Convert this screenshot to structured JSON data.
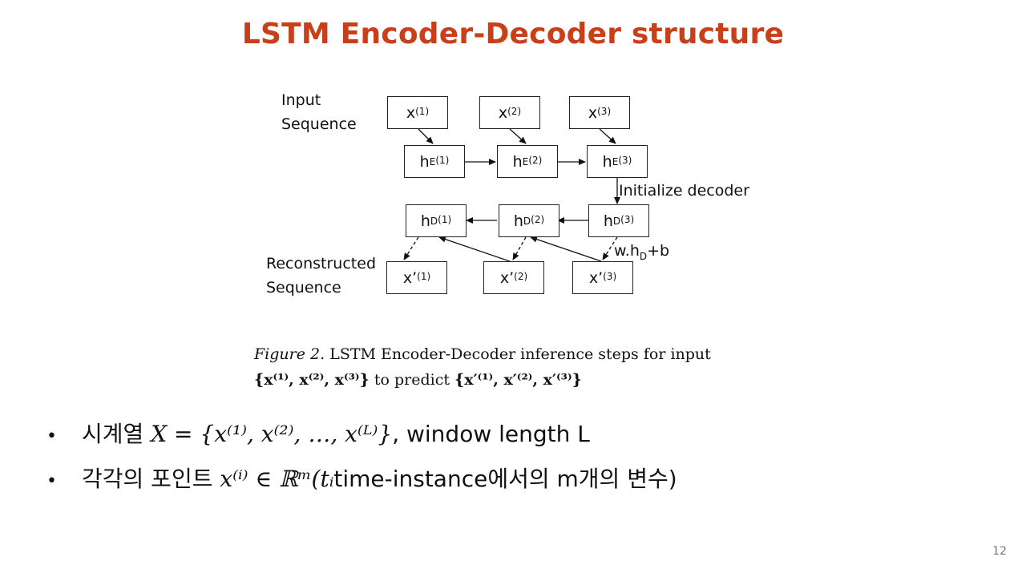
{
  "title": "LSTM Encoder-Decoder structure",
  "diagram": {
    "input_label_1": "Input",
    "input_label_2": "Sequence",
    "recon_label_1": "Reconstructed",
    "recon_label_2": "Sequence",
    "init_label": "Initialize decoder",
    "output_fn": "w.h",
    "output_fn_sub": "D",
    "output_fn_tail": "+b",
    "inputs": [
      {
        "base": "x",
        "sub": "",
        "sup": "(1)"
      },
      {
        "base": "x",
        "sub": "",
        "sup": "(2)"
      },
      {
        "base": "x",
        "sub": "",
        "sup": "(3)"
      }
    ],
    "encoders": [
      {
        "base": "h",
        "sub": "E",
        "sup": "(1)"
      },
      {
        "base": "h",
        "sub": "E",
        "sup": "(2)"
      },
      {
        "base": "h",
        "sub": "E",
        "sup": "(3)"
      }
    ],
    "decoders": [
      {
        "base": "h",
        "sub": "D",
        "sup": "(1)"
      },
      {
        "base": "h",
        "sub": "D",
        "sup": "(2)"
      },
      {
        "base": "h",
        "sub": "D",
        "sup": "(3)"
      }
    ],
    "outputs": [
      {
        "base": "x’",
        "sub": "",
        "sup": "(1)"
      },
      {
        "base": "x’",
        "sub": "",
        "sup": "(2)"
      },
      {
        "base": "x’",
        "sub": "",
        "sup": "(3)"
      }
    ]
  },
  "caption": {
    "fig_label": "Figure 2.",
    "line1": "LSTM Encoder-Decoder inference steps for input",
    "line2_a": "{x⁽¹⁾, x⁽²⁾, x⁽³⁾}",
    "line2_b": "to predict",
    "line2_c": "{x′⁽¹⁾, x′⁽²⁾, x′⁽³⁾}"
  },
  "bullets": [
    {
      "marker": "•",
      "prefix": "시계열",
      "math": "X = {x⁽¹⁾, x⁽²⁾,  …, x⁽ᴸ⁾}",
      "suffix": ", window length L"
    },
    {
      "marker": "•",
      "prefix": "각각의 포인트",
      "math": "x⁽ⁱ⁾ ∈ ℝᵐ(tᵢ",
      "suffix": " time-instance에서의 m개의 변수)"
    }
  ],
  "page_number": "12",
  "colors": {
    "title": "#c8401a",
    "text": "#111111"
  }
}
